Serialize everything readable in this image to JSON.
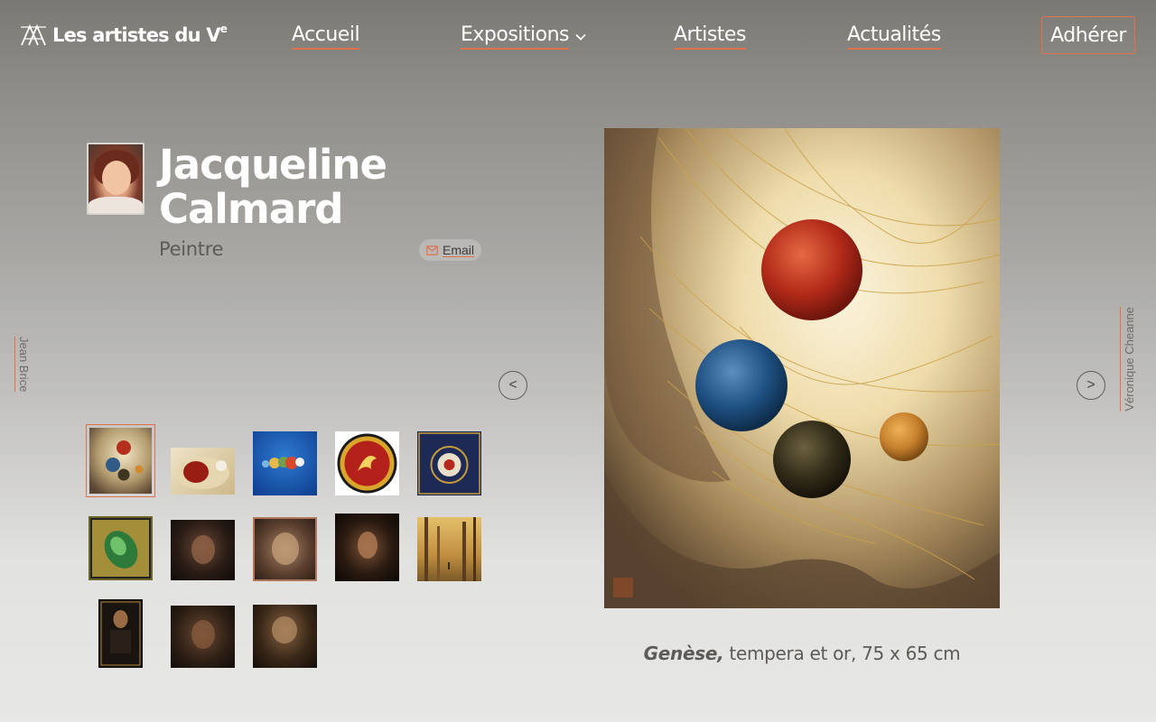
{
  "site": {
    "title": "Les artistes du V",
    "title_sup": "e"
  },
  "nav": {
    "home": "Accueil",
    "expos": "Expositions",
    "artists": "Artistes",
    "news": "Actualités",
    "join": "Adhérer"
  },
  "artist": {
    "first_name": "Jacqueline",
    "last_name": "Calmard",
    "role": "Peintre",
    "email_label": "Email"
  },
  "side_nav": {
    "previous_artist": "Jean Brice",
    "next_artist": "Véronique Cheanne"
  },
  "controls": {
    "prev": "<",
    "next": ">"
  },
  "thumbnails": [
    {
      "name": "thumb-genese",
      "selected": true
    },
    {
      "name": "thumb-red-stone"
    },
    {
      "name": "thumb-blue-spheres"
    },
    {
      "name": "thumb-phoenix-medallion"
    },
    {
      "name": "thumb-circle-blue"
    },
    {
      "name": "thumb-green-beetle"
    },
    {
      "name": "thumb-child-portrait-1"
    },
    {
      "name": "thumb-child-portrait-2"
    },
    {
      "name": "thumb-woman-portrait"
    },
    {
      "name": "thumb-forest"
    },
    {
      "name": "thumb-icon-portrait"
    },
    {
      "name": "thumb-child-portrait-3"
    },
    {
      "name": "thumb-child-portrait-4"
    }
  ],
  "artwork": {
    "title": "Genèse,",
    "details": " tempera et or, 75 x 65 cm"
  },
  "colors": {
    "accent": "#e0714f"
  }
}
